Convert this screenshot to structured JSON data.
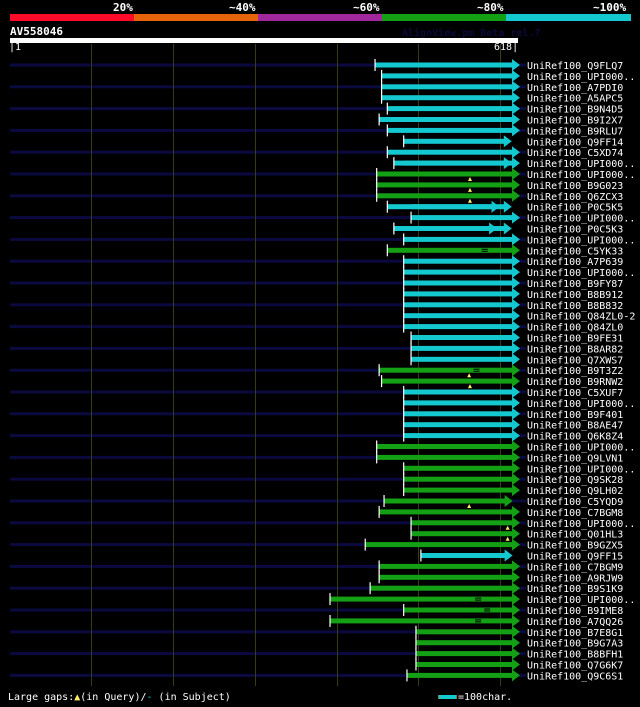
{
  "legend": {
    "items": [
      {
        "label": "20%",
        "color": "#ff0a28"
      },
      {
        "label": "~40%",
        "color": "#e8640a"
      },
      {
        "label": "~60%",
        "color": "#a0289c"
      },
      {
        "label": "~80%",
        "color": "#14a014"
      },
      {
        "label": "~100%",
        "color": "#14c8d0"
      }
    ]
  },
  "app_title": "AlignView.pm Beta rel.7",
  "query": {
    "name": "AV558046",
    "start": "1",
    "end": "618",
    "length": 618
  },
  "grid_step": 100,
  "colors": {
    "bg": "#000000",
    "backbone": "#0a0a40",
    "grid": "#3a3a14",
    "cyan": "#14c8d0",
    "green": "#14a014",
    "gap_query": "#ffee66",
    "tick": "#ffffff"
  },
  "hits": [
    {
      "name": "UniRef100_Q9FLQ7",
      "start": 447,
      "end": 618,
      "color": "cyan"
    },
    {
      "name": "UniRef100_UPI000..",
      "start": 455,
      "end": 618,
      "color": "cyan"
    },
    {
      "name": "UniRef100_A7PDI0",
      "start": 455,
      "end": 618,
      "color": "cyan"
    },
    {
      "name": "UniRef100_A5APC5",
      "start": 455,
      "end": 618,
      "color": "cyan"
    },
    {
      "name": "UniRef100_B9N4D5",
      "start": 462,
      "end": 618,
      "color": "cyan"
    },
    {
      "name": "UniRef100_B9I2X7",
      "start": 452,
      "end": 618,
      "color": "cyan"
    },
    {
      "name": "UniRef100_B9RLU7",
      "start": 462,
      "end": 618,
      "color": "cyan"
    },
    {
      "name": "UniRef100_Q9FF14",
      "start": 482,
      "end": 608,
      "color": "cyan"
    },
    {
      "name": "UniRef100_C5XD74",
      "start": 462,
      "end": 618,
      "color": "cyan"
    },
    {
      "name": "UniRef100_UPI000..",
      "start": 470,
      "end": 618,
      "color": "cyan",
      "segments": [
        [
          470,
          608
        ],
        [
          482,
          618
        ]
      ]
    },
    {
      "name": "UniRef100_UPI000..",
      "start": 449,
      "end": 618,
      "color": "green",
      "gap_query": 563
    },
    {
      "name": "UniRef100_B9G023",
      "start": 449,
      "end": 618,
      "color": "green",
      "gap_query": 563
    },
    {
      "name": "UniRef100_Q6ZCX3",
      "start": 449,
      "end": 618,
      "color": "green",
      "gap_query": 563
    },
    {
      "name": "UniRef100_P0C5K5",
      "start": 462,
      "end": 608,
      "color": "cyan",
      "segments": [
        [
          462,
          593
        ],
        [
          491,
          608
        ]
      ]
    },
    {
      "name": "UniRef100_UPI000..",
      "start": 491,
      "end": 618,
      "color": "cyan"
    },
    {
      "name": "UniRef100_P0C5K3",
      "start": 470,
      "end": 608,
      "color": "cyan",
      "segments": [
        [
          470,
          590
        ],
        [
          482,
          608
        ]
      ]
    },
    {
      "name": "UniRef100_UPI000..",
      "start": 482,
      "end": 618,
      "color": "cyan"
    },
    {
      "name": "UniRef100_C5YK33",
      "start": 462,
      "end": 618,
      "color": "green",
      "gap_subject": 581
    },
    {
      "name": "UniRef100_A7P639",
      "start": 482,
      "end": 618,
      "color": "cyan"
    },
    {
      "name": "UniRef100_UPI000..",
      "start": 482,
      "end": 618,
      "color": "cyan"
    },
    {
      "name": "UniRef100_B9FY87",
      "start": 482,
      "end": 618,
      "color": "cyan"
    },
    {
      "name": "UniRef100_B8B912",
      "start": 482,
      "end": 618,
      "color": "cyan"
    },
    {
      "name": "UniRef100_B8B832",
      "start": 482,
      "end": 618,
      "color": "cyan"
    },
    {
      "name": "UniRef100_Q84ZL0-2",
      "start": 482,
      "end": 618,
      "color": "cyan"
    },
    {
      "name": "UniRef100_Q84ZL0",
      "start": 482,
      "end": 618,
      "color": "cyan"
    },
    {
      "name": "UniRef100_B9FE31",
      "start": 491,
      "end": 618,
      "color": "cyan"
    },
    {
      "name": "UniRef100_B8AR82",
      "start": 491,
      "end": 618,
      "color": "cyan"
    },
    {
      "name": "UniRef100_Q7XWS7",
      "start": 491,
      "end": 618,
      "color": "cyan"
    },
    {
      "name": "UniRef100_B9T3Z2",
      "start": 452,
      "end": 618,
      "color": "green",
      "gap_query": 562,
      "gap_subject": 571
    },
    {
      "name": "UniRef100_B9RNW2",
      "start": 455,
      "end": 618,
      "color": "green",
      "gap_query": 563
    },
    {
      "name": "UniRef100_C5XUF7",
      "start": 482,
      "end": 618,
      "color": "cyan"
    },
    {
      "name": "UniRef100_UPI000..",
      "start": 482,
      "end": 618,
      "color": "cyan"
    },
    {
      "name": "UniRef100_B9F401",
      "start": 482,
      "end": 618,
      "color": "cyan"
    },
    {
      "name": "UniRef100_B8AE47",
      "start": 482,
      "end": 618,
      "color": "cyan"
    },
    {
      "name": "UniRef100_Q6K8Z4",
      "start": 482,
      "end": 618,
      "color": "cyan"
    },
    {
      "name": "UniRef100_UPI000..",
      "start": 449,
      "end": 618,
      "color": "green"
    },
    {
      "name": "UniRef100_Q9LVN1",
      "start": 449,
      "end": 618,
      "color": "green"
    },
    {
      "name": "UniRef100_UPI000..",
      "start": 482,
      "end": 618,
      "color": "green"
    },
    {
      "name": "UniRef100_Q9SK28",
      "start": 482,
      "end": 618,
      "color": "green"
    },
    {
      "name": "UniRef100_Q9LH02",
      "start": 482,
      "end": 618,
      "color": "green"
    },
    {
      "name": "UniRef100_C5YQD9",
      "start": 458,
      "end": 609,
      "color": "green",
      "gap_query": 562
    },
    {
      "name": "UniRef100_C7BGM8",
      "start": 452,
      "end": 618,
      "color": "green"
    },
    {
      "name": "UniRef100_UPI000..",
      "start": 491,
      "end": 618,
      "color": "green",
      "gap_query": 609
    },
    {
      "name": "UniRef100_Q01HL3",
      "start": 491,
      "end": 618,
      "color": "green",
      "gap_query": 609
    },
    {
      "name": "UniRef100_B9GZX5",
      "start": 435,
      "end": 618,
      "color": "green"
    },
    {
      "name": "UniRef100_Q9FF15",
      "start": 503,
      "end": 609,
      "color": "cyan"
    },
    {
      "name": "UniRef100_C7BGM9",
      "start": 452,
      "end": 618,
      "color": "green"
    },
    {
      "name": "UniRef100_A9RJW9",
      "start": 452,
      "end": 618,
      "color": "green"
    },
    {
      "name": "UniRef100_B9S1K9",
      "start": 441,
      "end": 618,
      "color": "green"
    },
    {
      "name": "UniRef100_UPI000..",
      "start": 392,
      "end": 618,
      "color": "green",
      "gap_subject": 573
    },
    {
      "name": "UniRef100_B9IME8",
      "start": 482,
      "end": 618,
      "color": "green",
      "gap_subject": 584
    },
    {
      "name": "UniRef100_A7QQ26",
      "start": 392,
      "end": 618,
      "color": "green",
      "gap_subject": 573
    },
    {
      "name": "UniRef100_B7E8G1",
      "start": 497,
      "end": 618,
      "color": "green"
    },
    {
      "name": "UniRef100_B9G7A3",
      "start": 497,
      "end": 618,
      "color": "green"
    },
    {
      "name": "UniRef100_B8BFH1",
      "start": 497,
      "end": 618,
      "color": "green"
    },
    {
      "name": "UniRef100_Q7G6K7",
      "start": 497,
      "end": 618,
      "color": "green"
    },
    {
      "name": "UniRef100_Q9C6S1",
      "start": 486,
      "end": 618,
      "color": "green"
    }
  ],
  "footer": {
    "gaps_label": "Large gaps:",
    "gap_query_glyph": "▲",
    "gap_query_text": "(in Query)/",
    "gap_subject_glyph": "-",
    "gap_subject_text": " (in Subject)",
    "scale_text": "=100char."
  }
}
